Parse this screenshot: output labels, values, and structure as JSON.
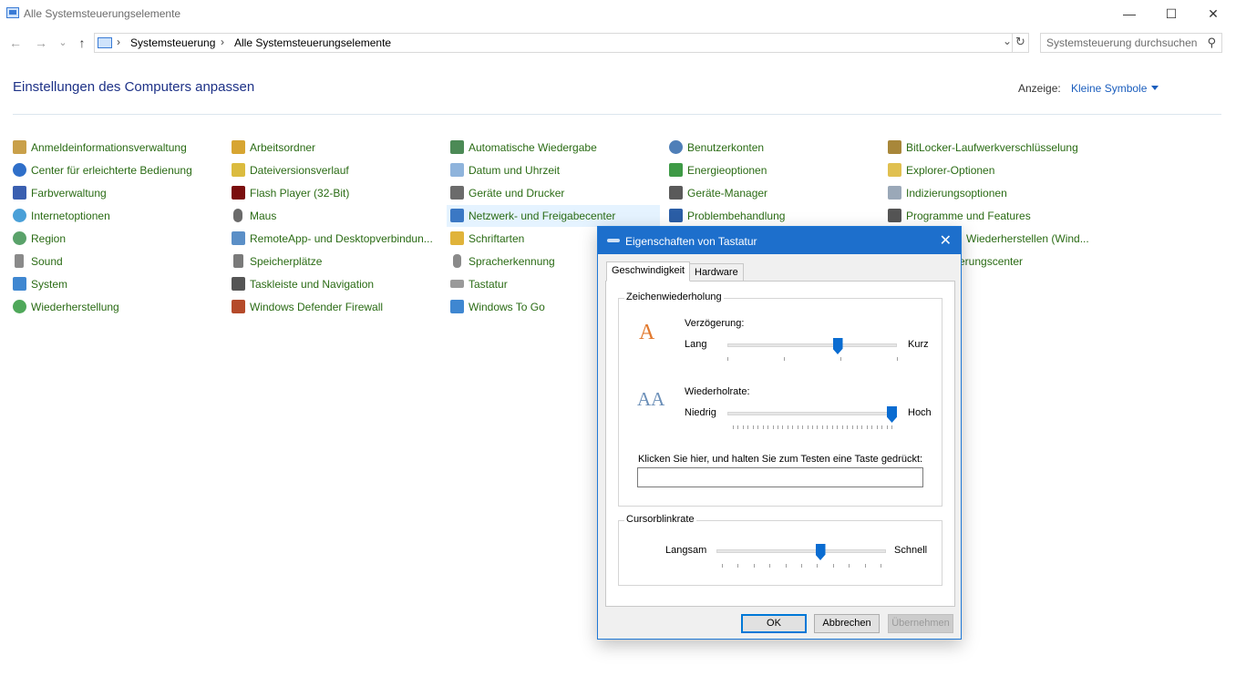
{
  "window": {
    "title": "Alle Systemsteuerungselemente",
    "minimize": "—",
    "maximize": "☐",
    "close": "✕"
  },
  "nav": {
    "back": "←",
    "forward": "→",
    "recent": "⌄",
    "up": "↑",
    "sep": "›",
    "breadcrumb": [
      "Systemsteuerung",
      "Alle Systemsteuerungselemente"
    ],
    "dropdown": "⌄",
    "refresh": "↻",
    "search_placeholder": "Systemsteuerung durchsuchen",
    "search_icon": "⚲"
  },
  "header": {
    "title": "Einstellungen des Computers anpassen",
    "view_label": "Anzeige:",
    "view_value": "Kleine Symbole"
  },
  "items": [
    [
      "Anmeldeinformationsverwaltung",
      "Center für erleichterte Bedienung",
      "Farbverwaltung",
      "Internetoptionen",
      "Region",
      "Sound",
      "System",
      "Wiederherstellung"
    ],
    [
      "Arbeitsordner",
      "Dateiversionsverlauf",
      "Flash Player (32-Bit)",
      "Maus",
      "RemoteApp- und Desktopverbindun...",
      "Speicherplätze",
      "Taskleiste und Navigation",
      "Windows Defender Firewall"
    ],
    [
      "Automatische Wiedergabe",
      "Datum und Uhrzeit",
      "Geräte und Drucker",
      "Netzwerk- und Freigabecenter",
      "Schriftarten",
      "Spracherkennung",
      "Tastatur",
      "Windows To Go"
    ],
    [
      "Benutzerkonten",
      "Energieoptionen",
      "Geräte-Manager",
      "Problembehandlung"
    ],
    [
      "BitLocker-Laufwerkverschlüsselung",
      "Explorer-Optionen",
      "Indizierungsoptionen",
      "Programme und Features",
      "Wiederherstellen (Wind...",
      "erungscenter"
    ]
  ],
  "dialog": {
    "title": "Eigenschaften von Tastatur",
    "close": "✕",
    "tabs": [
      "Geschwindigkeit",
      "Hardware"
    ],
    "group1": {
      "legend": "Zeichenwiederholung",
      "delay_label": "Verzögerung:",
      "delay_min": "Lang",
      "delay_max": "Kurz",
      "delay_value": 0.66,
      "rate_label": "Wiederholrate:",
      "rate_min": "Niedrig",
      "rate_max": "Hoch",
      "rate_value": 1.0,
      "test_label": "Klicken Sie hier, und halten Sie zum Testen eine Taste gedrückt:"
    },
    "group2": {
      "legend": "Cursorblinkrate",
      "min": "Langsam",
      "max": "Schnell",
      "value": 0.62
    },
    "buttons": {
      "ok": "OK",
      "cancel": "Abbrechen",
      "apply": "Übernehmen"
    }
  }
}
